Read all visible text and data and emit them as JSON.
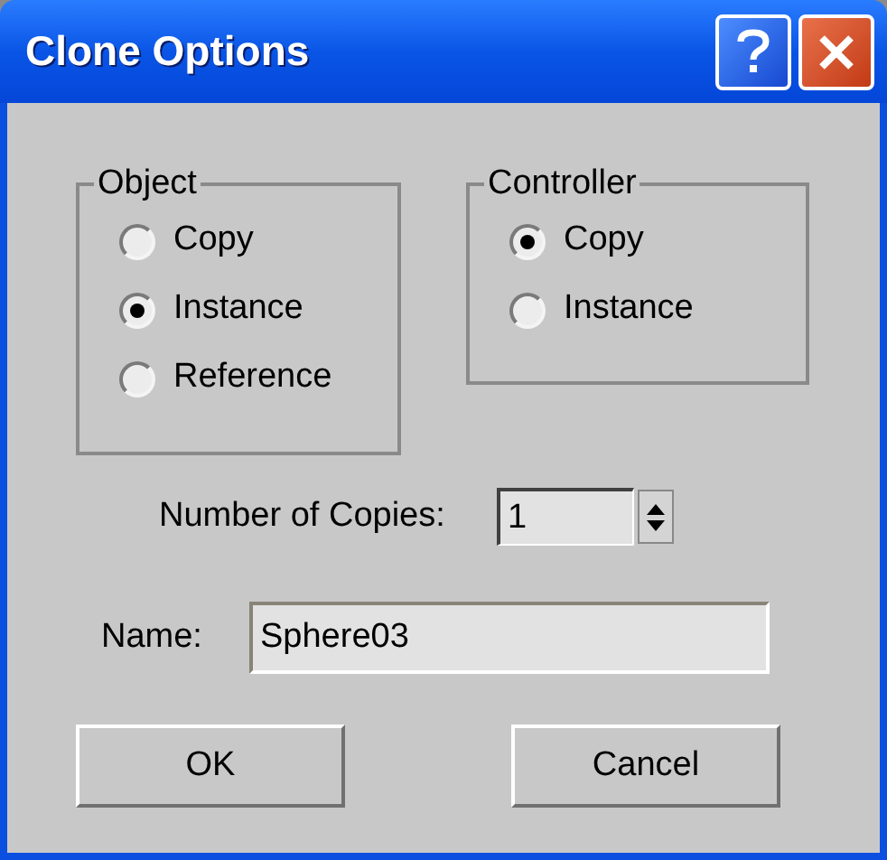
{
  "window": {
    "title": "Clone Options"
  },
  "groups": [
    {
      "title": "Object",
      "options": [
        {
          "label": "Copy",
          "selected": false
        },
        {
          "label": "Instance",
          "selected": true
        },
        {
          "label": "Reference",
          "selected": false
        }
      ]
    },
    {
      "title": "Controller",
      "options": [
        {
          "label": "Copy",
          "selected": true
        },
        {
          "label": "Instance",
          "selected": false
        }
      ]
    }
  ],
  "copies": {
    "label": "Number of Copies:",
    "value": "1"
  },
  "name": {
    "label": "Name:",
    "value": "Sphere03"
  },
  "buttons": [
    "OK",
    "Cancel"
  ]
}
